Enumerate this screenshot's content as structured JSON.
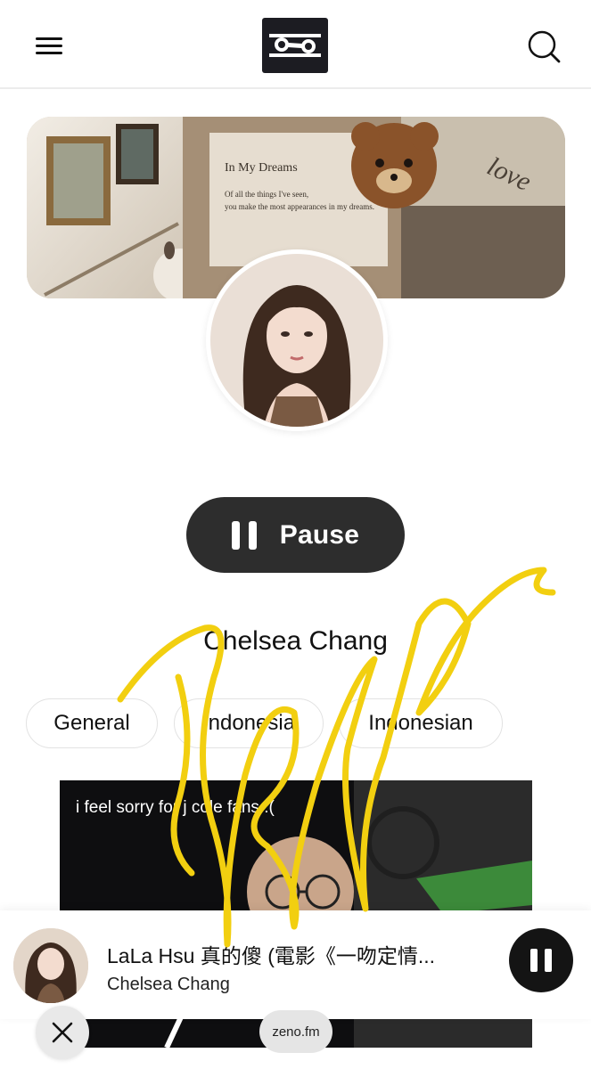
{
  "header": {
    "menu_icon": "hamburger-menu-icon",
    "logo_icon": "zeno-logo-icon",
    "search_icon": "search-icon"
  },
  "banner": {
    "card_title": "In My Dreams",
    "card_line1": "Of all the things I've seen,",
    "card_line2": "you make the most appearances in my dreams.",
    "love_text": "love"
  },
  "player": {
    "pause_label": "Pause",
    "station_name": "Chelsea Chang"
  },
  "tags": [
    "General",
    "Indonesia",
    "Indonesian"
  ],
  "video": {
    "caption": "i feel sorry for j cole fans :("
  },
  "mini_player": {
    "title": "LaLa Hsu 真的傻 (電影《一吻定情...",
    "artist": "Chelsea Chang",
    "pause_icon": "pause-icon"
  },
  "footer": {
    "close_icon": "close-icon",
    "badge": "zeno.fm"
  },
  "colors": {
    "accent_dark": "#2d2d2d",
    "scribble": "#f2cf10"
  }
}
